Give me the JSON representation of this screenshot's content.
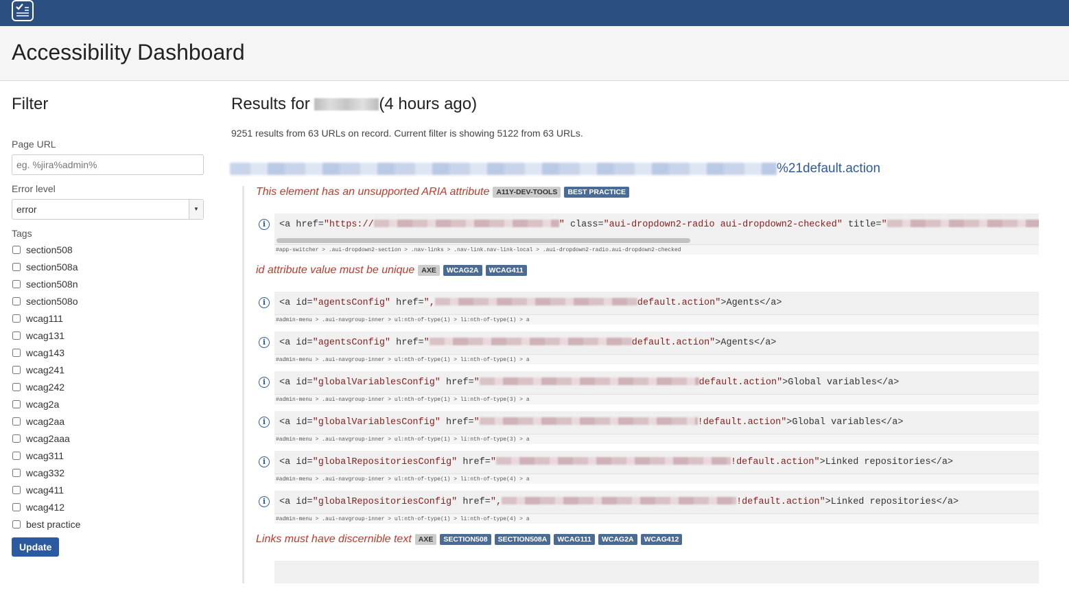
{
  "app": {
    "logo_icon": "checklist-icon",
    "title": "Accessibility Dashboard"
  },
  "filter": {
    "title": "Filter",
    "page_url_label": "Page URL",
    "page_url_placeholder": "eg. %jira%admin%",
    "page_url_value": "",
    "error_level_label": "Error level",
    "error_level_value": "error",
    "tags_label": "Tags",
    "tags": [
      "section508",
      "section508a",
      "section508n",
      "section508o",
      "wcag111",
      "wcag131",
      "wcag143",
      "wcag241",
      "wcag242",
      "wcag2a",
      "wcag2aa",
      "wcag2aaa",
      "wcag311",
      "wcag332",
      "wcag411",
      "wcag412",
      "best practice"
    ],
    "update_label": "Update"
  },
  "results": {
    "title_prefix": "Results for",
    "title_suffix": "(4 hours ago)",
    "summary": "9251 results from 63 URLs on record. Current filter is showing 5122 from 63 URLs.",
    "url_suffix": "%21default.action",
    "issues": [
      {
        "title": "This element has an unsupported ARIA attribute",
        "badges": [
          {
            "t": "A11Y-DEV-TOOLS",
            "c": "gray"
          },
          {
            "t": "BEST PRACTICE",
            "c": "blue"
          }
        ],
        "snippets": [
          {
            "scroll": true,
            "code": [
              [
                "t",
                "<a href="
              ],
              [
                "v",
                "\"https://"
              ],
              [
                "b",
                270
              ],
              [
                "v",
                "\""
              ],
              [
                "t",
                " class="
              ],
              [
                "v",
                "\"aui-dropdown2-radio aui-dropdown2-checked\""
              ],
              [
                "t",
                " title="
              ],
              [
                "v",
                "\""
              ],
              [
                "b",
                240
              ]
            ],
            "selector": "#app-switcher > .aui-dropdown2-section > .nav-links > .nav-link.nav-link-local > .aui-dropdown2-radio.aui-dropdown2-checked"
          }
        ]
      },
      {
        "title": "id attribute value must be unique",
        "badges": [
          {
            "t": "AXE",
            "c": "gray"
          },
          {
            "t": "WCAG2A",
            "c": "blue"
          },
          {
            "t": "WCAG411",
            "c": "blue"
          }
        ],
        "snippets": [
          {
            "code": [
              [
                "t",
                "<a id="
              ],
              [
                "v",
                "\"agentsConfig\""
              ],
              [
                "t",
                " href="
              ],
              [
                "v",
                "\","
              ],
              [
                "b",
                295
              ],
              [
                "v",
                "default.action\""
              ],
              [
                "t",
                ">Agents</a>"
              ]
            ],
            "selector": "#admin-menu > .aui-navgroup-inner > ul:nth-of-type(1) > li:nth-of-type(1) > a"
          },
          {
            "code": [
              [
                "t",
                "<a id="
              ],
              [
                "v",
                "\"agentsConfig\""
              ],
              [
                "t",
                " href="
              ],
              [
                "v",
                "\""
              ],
              [
                "b",
                295
              ],
              [
                "v",
                "default.action\""
              ],
              [
                "t",
                ">Agents</a>"
              ]
            ],
            "selector": "#admin-menu > .aui-navgroup-inner > ul:nth-of-type(1) > li:nth-of-type(1) > a"
          },
          {
            "code": [
              [
                "t",
                "<a id="
              ],
              [
                "v",
                "\"globalVariablesConfig\""
              ],
              [
                "t",
                " href="
              ],
              [
                "v",
                "\""
              ],
              [
                "b",
                320
              ],
              [
                "v",
                "default.action\""
              ],
              [
                "t",
                ">Global variables</a>"
              ]
            ],
            "selector": "#admin-menu > .aui-navgroup-inner > ul:nth-of-type(1) > li:nth-of-type(3) > a"
          },
          {
            "code": [
              [
                "t",
                "<a id="
              ],
              [
                "v",
                "\"globalVariablesConfig\""
              ],
              [
                "t",
                " href="
              ],
              [
                "v",
                "\""
              ],
              [
                "b",
                318
              ],
              [
                "v",
                "!default.action\""
              ],
              [
                "t",
                ">Global variables</a>"
              ]
            ],
            "selector": "#admin-menu > .aui-navgroup-inner > ul:nth-of-type(1) > li:nth-of-type(3) > a"
          },
          {
            "code": [
              [
                "t",
                "<a id="
              ],
              [
                "v",
                "\"globalRepositoriesConfig\""
              ],
              [
                "t",
                " href="
              ],
              [
                "v",
                "\""
              ],
              [
                "b",
                342
              ],
              [
                "v",
                "!default.action\""
              ],
              [
                "t",
                ">Linked repositories</a>"
              ]
            ],
            "selector": "#admin-menu > .aui-navgroup-inner > ul:nth-of-type(1) > li:nth-of-type(4) > a"
          },
          {
            "code": [
              [
                "t",
                "<a id="
              ],
              [
                "v",
                "\"globalRepositoriesConfig\""
              ],
              [
                "t",
                " href="
              ],
              [
                "v",
                "\","
              ],
              [
                "b",
                342
              ],
              [
                "v",
                "!default.action\""
              ],
              [
                "t",
                ">Linked repositories</a>"
              ]
            ],
            "selector": "#admin-menu > .aui-navgroup-inner > ul:nth-of-type(1) > li:nth-of-type(4) > a"
          }
        ]
      },
      {
        "title": "Links must have discernible text",
        "badges": [
          {
            "t": "AXE",
            "c": "gray"
          },
          {
            "t": "SECTION508",
            "c": "blue"
          },
          {
            "t": "SECTION508A",
            "c": "blue"
          },
          {
            "t": "WCAG111",
            "c": "blue"
          },
          {
            "t": "WCAG2A",
            "c": "blue"
          },
          {
            "t": "WCAG412",
            "c": "blue"
          }
        ],
        "snippets": [
          {
            "code": [],
            "selector": ""
          }
        ]
      }
    ]
  },
  "colors": {
    "topbar": "#2b4f81",
    "accent": "#2b5aa0",
    "issue": "#c0392b"
  }
}
